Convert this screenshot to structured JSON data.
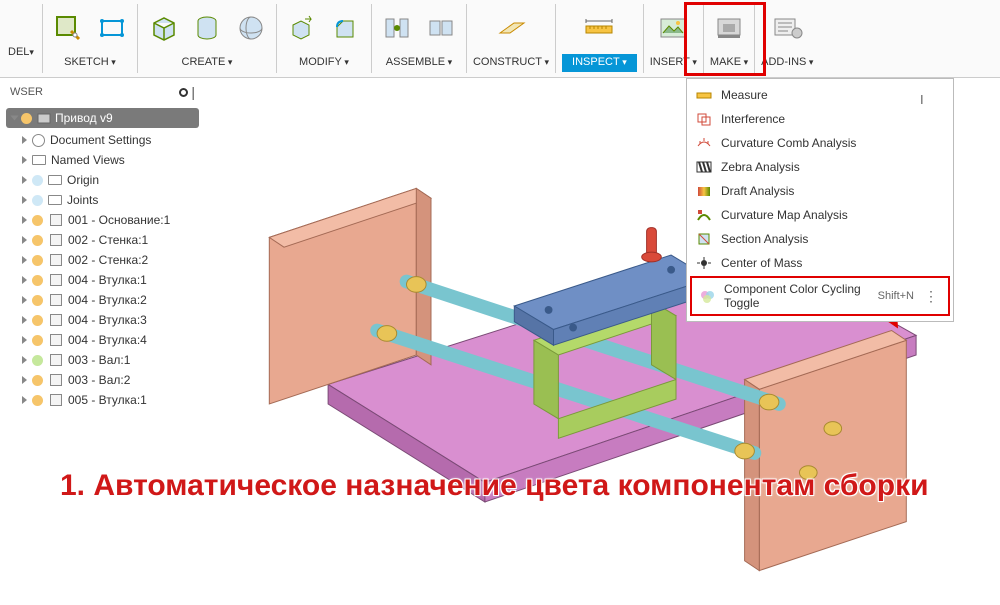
{
  "workspace_label": "DEL",
  "toolbar": {
    "sketch": "SKETCH",
    "create": "CREATE",
    "modify": "MODIFY",
    "assemble": "ASSEMBLE",
    "construct": "CONSTRUCT",
    "inspect": "INSPECT",
    "insert": "INSERT",
    "make": "MAKE",
    "addins": "ADD-INS"
  },
  "browser_title": "WSER",
  "root": "Привод v9",
  "tree": {
    "doc_settings": "Document Settings",
    "named_views": "Named Views",
    "origin": "Origin",
    "joints": "Joints",
    "parts": [
      {
        "label": "001 - Основание:1",
        "color": "#f6c56a"
      },
      {
        "label": "002 - Стенка:1",
        "color": "#f6c56a"
      },
      {
        "label": "002 - Стенка:2",
        "color": "#f6c56a"
      },
      {
        "label": "004 - Втулка:1",
        "color": "#f6c56a"
      },
      {
        "label": "004 - Втулка:2",
        "color": "#f6c56a"
      },
      {
        "label": "004 - Втулка:3",
        "color": "#f6c56a"
      },
      {
        "label": "004 - Втулка:4",
        "color": "#f6c56a"
      },
      {
        "label": "003 - Вал:1",
        "color": "#c5e89c"
      },
      {
        "label": "003 - Вал:2",
        "color": "#f6c56a"
      },
      {
        "label": "005 - Втулка:1",
        "color": "#f6c56a"
      }
    ]
  },
  "dropdown": [
    {
      "icon": "ruler",
      "label": "Measure"
    },
    {
      "icon": "interf",
      "label": "Interference"
    },
    {
      "icon": "comb",
      "label": "Curvature Comb Analysis"
    },
    {
      "icon": "zebra",
      "label": "Zebra Analysis"
    },
    {
      "icon": "draft",
      "label": "Draft Analysis"
    },
    {
      "icon": "curvmap",
      "label": "Curvature Map Analysis"
    },
    {
      "icon": "section",
      "label": "Section Analysis"
    },
    {
      "icon": "com",
      "label": "Center of Mass"
    },
    {
      "icon": "ccc",
      "label": "Component Color Cycling Toggle",
      "shortcut": "Shift+N",
      "hl": true
    }
  ],
  "shortcut_hint": "I",
  "annotation": "1. Автоматическое назначение цвета компонентам сборки"
}
